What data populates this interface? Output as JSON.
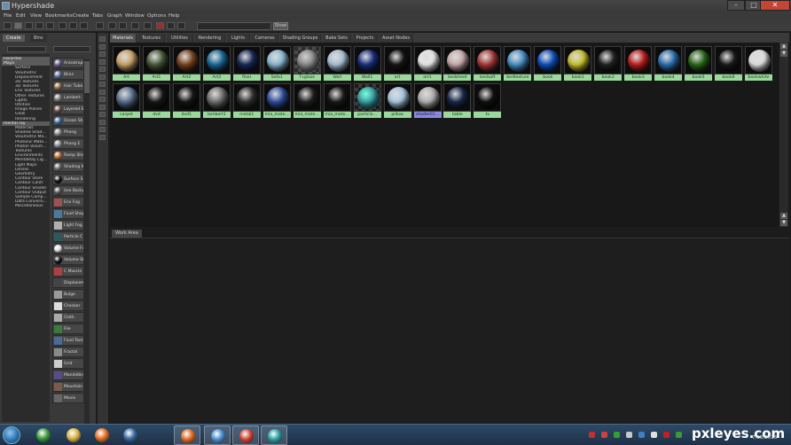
{
  "window": {
    "title": "Hypershade",
    "minimize_icon": "minimize-icon",
    "maximize_icon": "maximize-icon",
    "close_icon": "close-icon"
  },
  "menus": [
    "File",
    "Edit",
    "View",
    "Bookmarks",
    "Create",
    "Tabs",
    "Graph",
    "Window",
    "Options",
    "Help"
  ],
  "toolbar": {
    "show_label": "Show"
  },
  "left_tabs": [
    "Create",
    "Bins"
  ],
  "tree_items": [
    {
      "label": "Favorites",
      "header": true
    },
    {
      "label": "Maya",
      "header": true
    },
    {
      "label": "Surface",
      "header": false
    },
    {
      "label": "Volumetric",
      "header": false
    },
    {
      "label": "Displacement",
      "header": false
    },
    {
      "label": "2D Textures",
      "header": false
    },
    {
      "label": "3D Textures",
      "header": false
    },
    {
      "label": "Env Textures",
      "header": false
    },
    {
      "label": "Other Textures",
      "header": false
    },
    {
      "label": "Lights",
      "header": false
    },
    {
      "label": "Utilities",
      "header": false
    },
    {
      "label": "Image Planes",
      "header": false
    },
    {
      "label": "Glow",
      "header": false
    },
    {
      "label": "Rendering",
      "header": false
    },
    {
      "label": "mental ray",
      "header": true
    },
    {
      "label": "Materials",
      "header": false
    },
    {
      "label": "Shadow Shad...",
      "header": false
    },
    {
      "label": "Volumetric Ma...",
      "header": false
    },
    {
      "label": "Photonic Mate...",
      "header": false
    },
    {
      "label": "Photon Volum...",
      "header": false
    },
    {
      "label": "Textures",
      "header": false
    },
    {
      "label": "Environments",
      "header": false
    },
    {
      "label": "MentalRay Lig...",
      "header": false
    },
    {
      "label": "Light Maps",
      "header": false
    },
    {
      "label": "Lenses",
      "header": false
    },
    {
      "label": "Geometry",
      "header": false
    },
    {
      "label": "Contour Store",
      "header": false
    },
    {
      "label": "Contour Contr",
      "header": false
    },
    {
      "label": "Contour Shader",
      "header": false
    },
    {
      "label": "Contour Output",
      "header": false
    },
    {
      "label": "Sample Comp...",
      "header": false
    },
    {
      "label": "Data Conversi...",
      "header": false
    },
    {
      "label": "Miscellaneous",
      "header": false
    }
  ],
  "node_buttons": [
    {
      "label": "Anisotropic",
      "color": "#6a5a90",
      "shape": "ball"
    },
    {
      "label": "Blinn",
      "color": "#5a6a9a",
      "shape": "ball"
    },
    {
      "label": "Hair Tube",
      "color": "#8a6a40",
      "shape": "ball"
    },
    {
      "label": "Lambert",
      "color": "#7a7a7a",
      "shape": "ball"
    },
    {
      "label": "Layered S",
      "color": "#6a4a4a",
      "shape": "ball"
    },
    {
      "label": "Ocean Sh",
      "color": "#3a6a9a",
      "shape": "ball"
    },
    {
      "label": "Phong",
      "color": "#8a8a8a",
      "shape": "ball"
    },
    {
      "label": "Phong E",
      "color": "#8a8a9a",
      "shape": "ball"
    },
    {
      "label": "Ramp Sha",
      "color": "#c07030",
      "shape": "ball"
    },
    {
      "label": "Shading M",
      "color": "#6a6a6a",
      "shape": "ball"
    },
    {
      "label": "Surface S",
      "color": "#111111",
      "shape": "ball"
    },
    {
      "label": "Use Backg",
      "color": "#555555",
      "shape": "ball"
    },
    {
      "label": "Env Fog",
      "color": "#a05050",
      "shape": "sq"
    },
    {
      "label": "Fluid Shap",
      "color": "#4a7a9a",
      "shape": "sq"
    },
    {
      "label": "Light Fog",
      "color": "#b0b0b0",
      "shape": "sq"
    },
    {
      "label": "Particle C",
      "color": "#2a5a5a",
      "shape": "sq"
    },
    {
      "label": "Volume Fo",
      "color": "#dddddd",
      "shape": "ball"
    },
    {
      "label": "Volume Sh",
      "color": "#111111",
      "shape": "ball"
    },
    {
      "label": "C Muscle",
      "color": "#b04040",
      "shape": "sq"
    },
    {
      "label": "Displacem",
      "color": "#444444",
      "shape": "sq"
    },
    {
      "label": "Bulge",
      "color": "#9a9a9a",
      "shape": "sq"
    },
    {
      "label": "Checker",
      "color": "#dddddd",
      "shape": "sq"
    },
    {
      "label": "Cloth",
      "color": "#aaaaaa",
      "shape": "sq"
    },
    {
      "label": "File",
      "color": "#3a7a3a",
      "shape": "sq"
    },
    {
      "label": "Fluid Text",
      "color": "#4a6a9a",
      "shape": "sq"
    },
    {
      "label": "Fractal",
      "color": "#8a8a8a",
      "shape": "sq"
    },
    {
      "label": "Grid",
      "color": "#cccccc",
      "shape": "sq"
    },
    {
      "label": "Mandelbro",
      "color": "#5a4a8a",
      "shape": "sq"
    },
    {
      "label": "Mountain",
      "color": "#7a5a4a",
      "shape": "sq"
    },
    {
      "label": "Movie",
      "color": "#666666",
      "shape": "sq"
    }
  ],
  "top_tabs": [
    "Materials",
    "Textures",
    "Utilities",
    "Rendering",
    "Lights",
    "Cameras",
    "Shading Groups",
    "Bake Sets",
    "Projects",
    "Asset Nodes"
  ],
  "materials_row1": [
    {
      "label": "Art",
      "color": "#c9a46a",
      "sel": false
    },
    {
      "label": "Art1",
      "color": "#4a5a3a",
      "sel": false
    },
    {
      "label": "Art2",
      "color": "#7a4420",
      "sel": false
    },
    {
      "label": "Art3",
      "color": "#1a6a9a",
      "sel": false
    },
    {
      "label": "floor",
      "color": "#1a2a5a",
      "sel": false
    },
    {
      "label": "Sofa1",
      "color": "#8ab8d0",
      "sel": false
    },
    {
      "label": "Tvglaze",
      "color": "#707070",
      "sel": false
    },
    {
      "label": "Wall",
      "color": "#a8c0d4",
      "sel": false
    },
    {
      "label": "Wall1",
      "color": "#1a3080",
      "sel": false
    },
    {
      "label": "art",
      "color": "#151515",
      "sel": false
    },
    {
      "label": "art1",
      "color": "#e8e8e8",
      "sel": false
    },
    {
      "label": "bedsheet",
      "color": "#c8aaaa",
      "sel": false
    },
    {
      "label": "bedsoft",
      "color": "#a83a3a",
      "sel": false
    },
    {
      "label": "bedtexture",
      "color": "#4a90c8",
      "sel": false
    },
    {
      "label": "book",
      "color": "#1050c0",
      "sel": false
    },
    {
      "label": "book1",
      "color": "#c8c030",
      "sel": false
    },
    {
      "label": "book2",
      "color": "#222222",
      "sel": false
    },
    {
      "label": "book3",
      "color": "#c02020",
      "sel": false
    },
    {
      "label": "book4",
      "color": "#2a70b0",
      "sel": false
    },
    {
      "label": "book5",
      "color": "#2a6a1a",
      "sel": false
    },
    {
      "label": "book6",
      "color": "#1a1a1a",
      "sel": false
    },
    {
      "label": "bookwhite",
      "color": "#e0e0e0",
      "sel": false
    }
  ],
  "materials_row2": [
    {
      "label": "carpet",
      "color": "#5a7090",
      "sel": false
    },
    {
      "label": "dvd",
      "color": "#181818",
      "sel": false
    },
    {
      "label": "dvd1",
      "color": "#161616",
      "sel": false
    },
    {
      "label": "lambert1",
      "color": "#707070",
      "sel": false
    },
    {
      "label": "metal1",
      "color": "#303030",
      "sel": false
    },
    {
      "label": "mia_mate...",
      "color": "#3050a0",
      "sel": false
    },
    {
      "label": "mia_mate...",
      "color": "#202020",
      "sel": false
    },
    {
      "label": "mia_mate...",
      "color": "#1a1a1a",
      "sel": false
    },
    {
      "label": "particle...",
      "color": "#2a7a8a",
      "sel": false
    },
    {
      "label": "pillow",
      "color": "#a8c8e0",
      "sel": false
    },
    {
      "label": "shader01...",
      "color": "#b0b0b0",
      "sel": true
    },
    {
      "label": "table",
      "color": "#1a2a4a",
      "sel": false
    },
    {
      "label": "tv",
      "color": "#101010",
      "sel": false
    }
  ],
  "work_area_label": "Work Area",
  "taskbar_apps": [
    {
      "name": "utorrent",
      "color": "#3a9a3a"
    },
    {
      "name": "file-explorer",
      "color": "#d8b040"
    },
    {
      "name": "media-player",
      "color": "#e07020"
    },
    {
      "name": "eye-app",
      "color": "#3a6aa0"
    },
    {
      "name": "firefox",
      "color": "#e06a20"
    },
    {
      "name": "globe-app",
      "color": "#4a8ad0"
    },
    {
      "name": "chrome",
      "color": "#d04030"
    },
    {
      "name": "maya",
      "color": "#2aa0a0"
    }
  ],
  "watermark": "pxleyes.com",
  "clock_date": "7/18/2013"
}
